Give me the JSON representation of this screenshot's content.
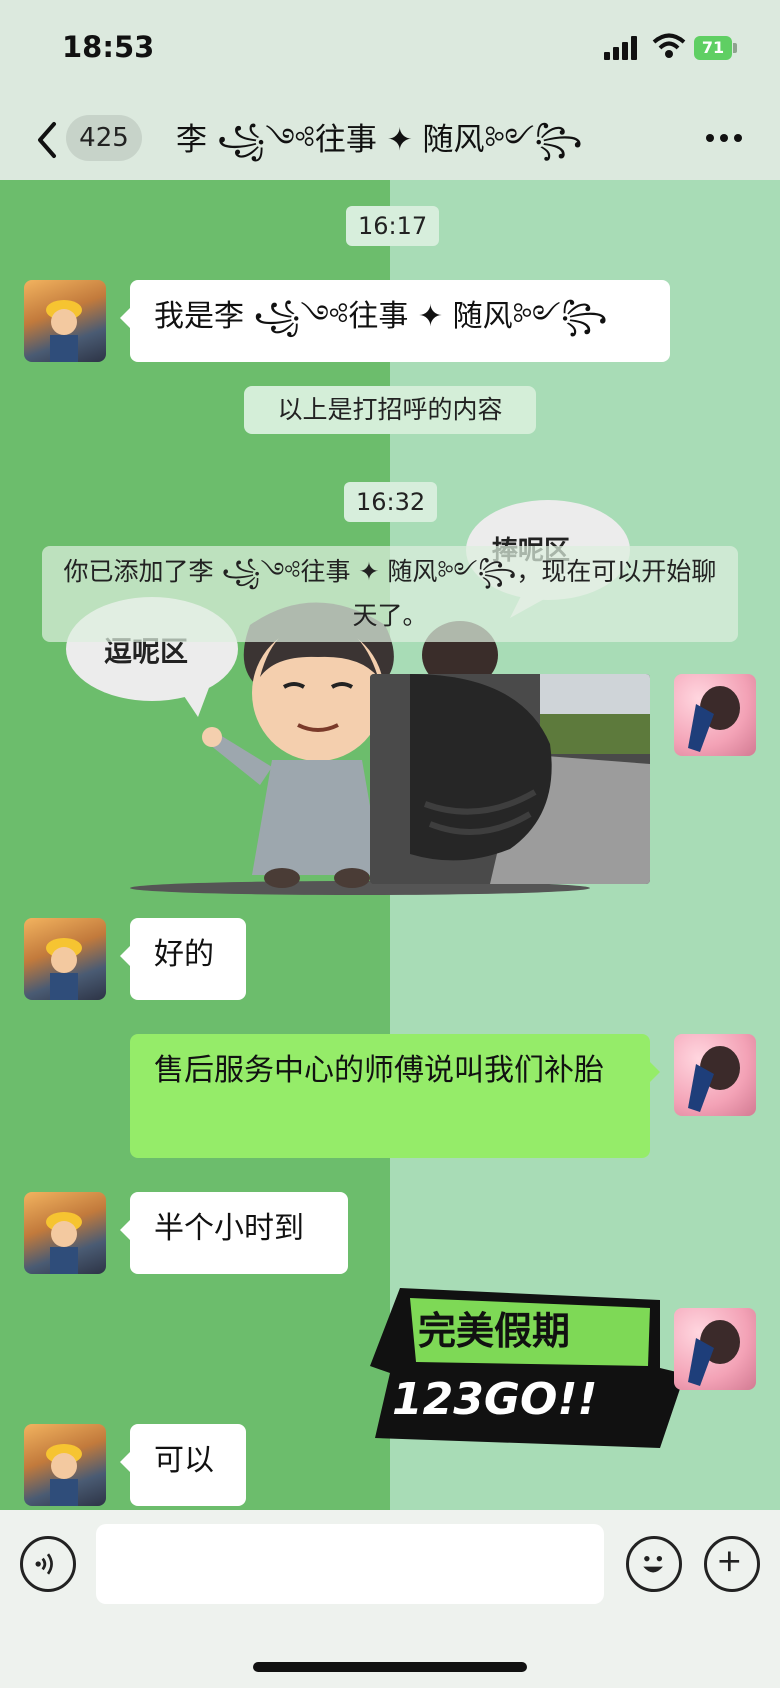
{
  "status_bar": {
    "time": "18:53",
    "battery": "71"
  },
  "header": {
    "unread_count": "425",
    "title": "李 ꧁༺往事 ✦ 随风༻꧂"
  },
  "messages": [
    {
      "type": "time",
      "text": "16:17"
    },
    {
      "type": "received",
      "text": "我是李 ꧁༺往事 ✦ 随风༻꧂"
    },
    {
      "type": "system",
      "text": "以上是打招呼的内容"
    },
    {
      "type": "time",
      "text": "16:32"
    },
    {
      "type": "system",
      "text": "你已添加了李 ꧁༺往事 ✦ 随风༻꧂，现在可以开始聊天了。"
    },
    {
      "type": "sticker",
      "caption": "逗呢区"
    },
    {
      "type": "sticker",
      "caption": "捧呢区"
    },
    {
      "type": "received",
      "text": "好的"
    },
    {
      "type": "sent",
      "text": "售后服务中心的师傅说叫我们补胎"
    },
    {
      "type": "received",
      "text": "半个小时到"
    },
    {
      "type": "sticker",
      "line1": "完美假期",
      "line2": "123GO!!"
    },
    {
      "type": "received",
      "text": "可以"
    }
  ],
  "icons": {
    "back": "chevron-left-icon",
    "more": "more-dots-icon",
    "voice": "voice-icon",
    "emoji": "emoji-icon",
    "plus": "plus-icon"
  },
  "colors": {
    "sent_bubble": "#95ec69",
    "received_bubble": "#ffffff",
    "bg_left": "#6cbd6c",
    "bg_right": "#a8dcb6"
  }
}
